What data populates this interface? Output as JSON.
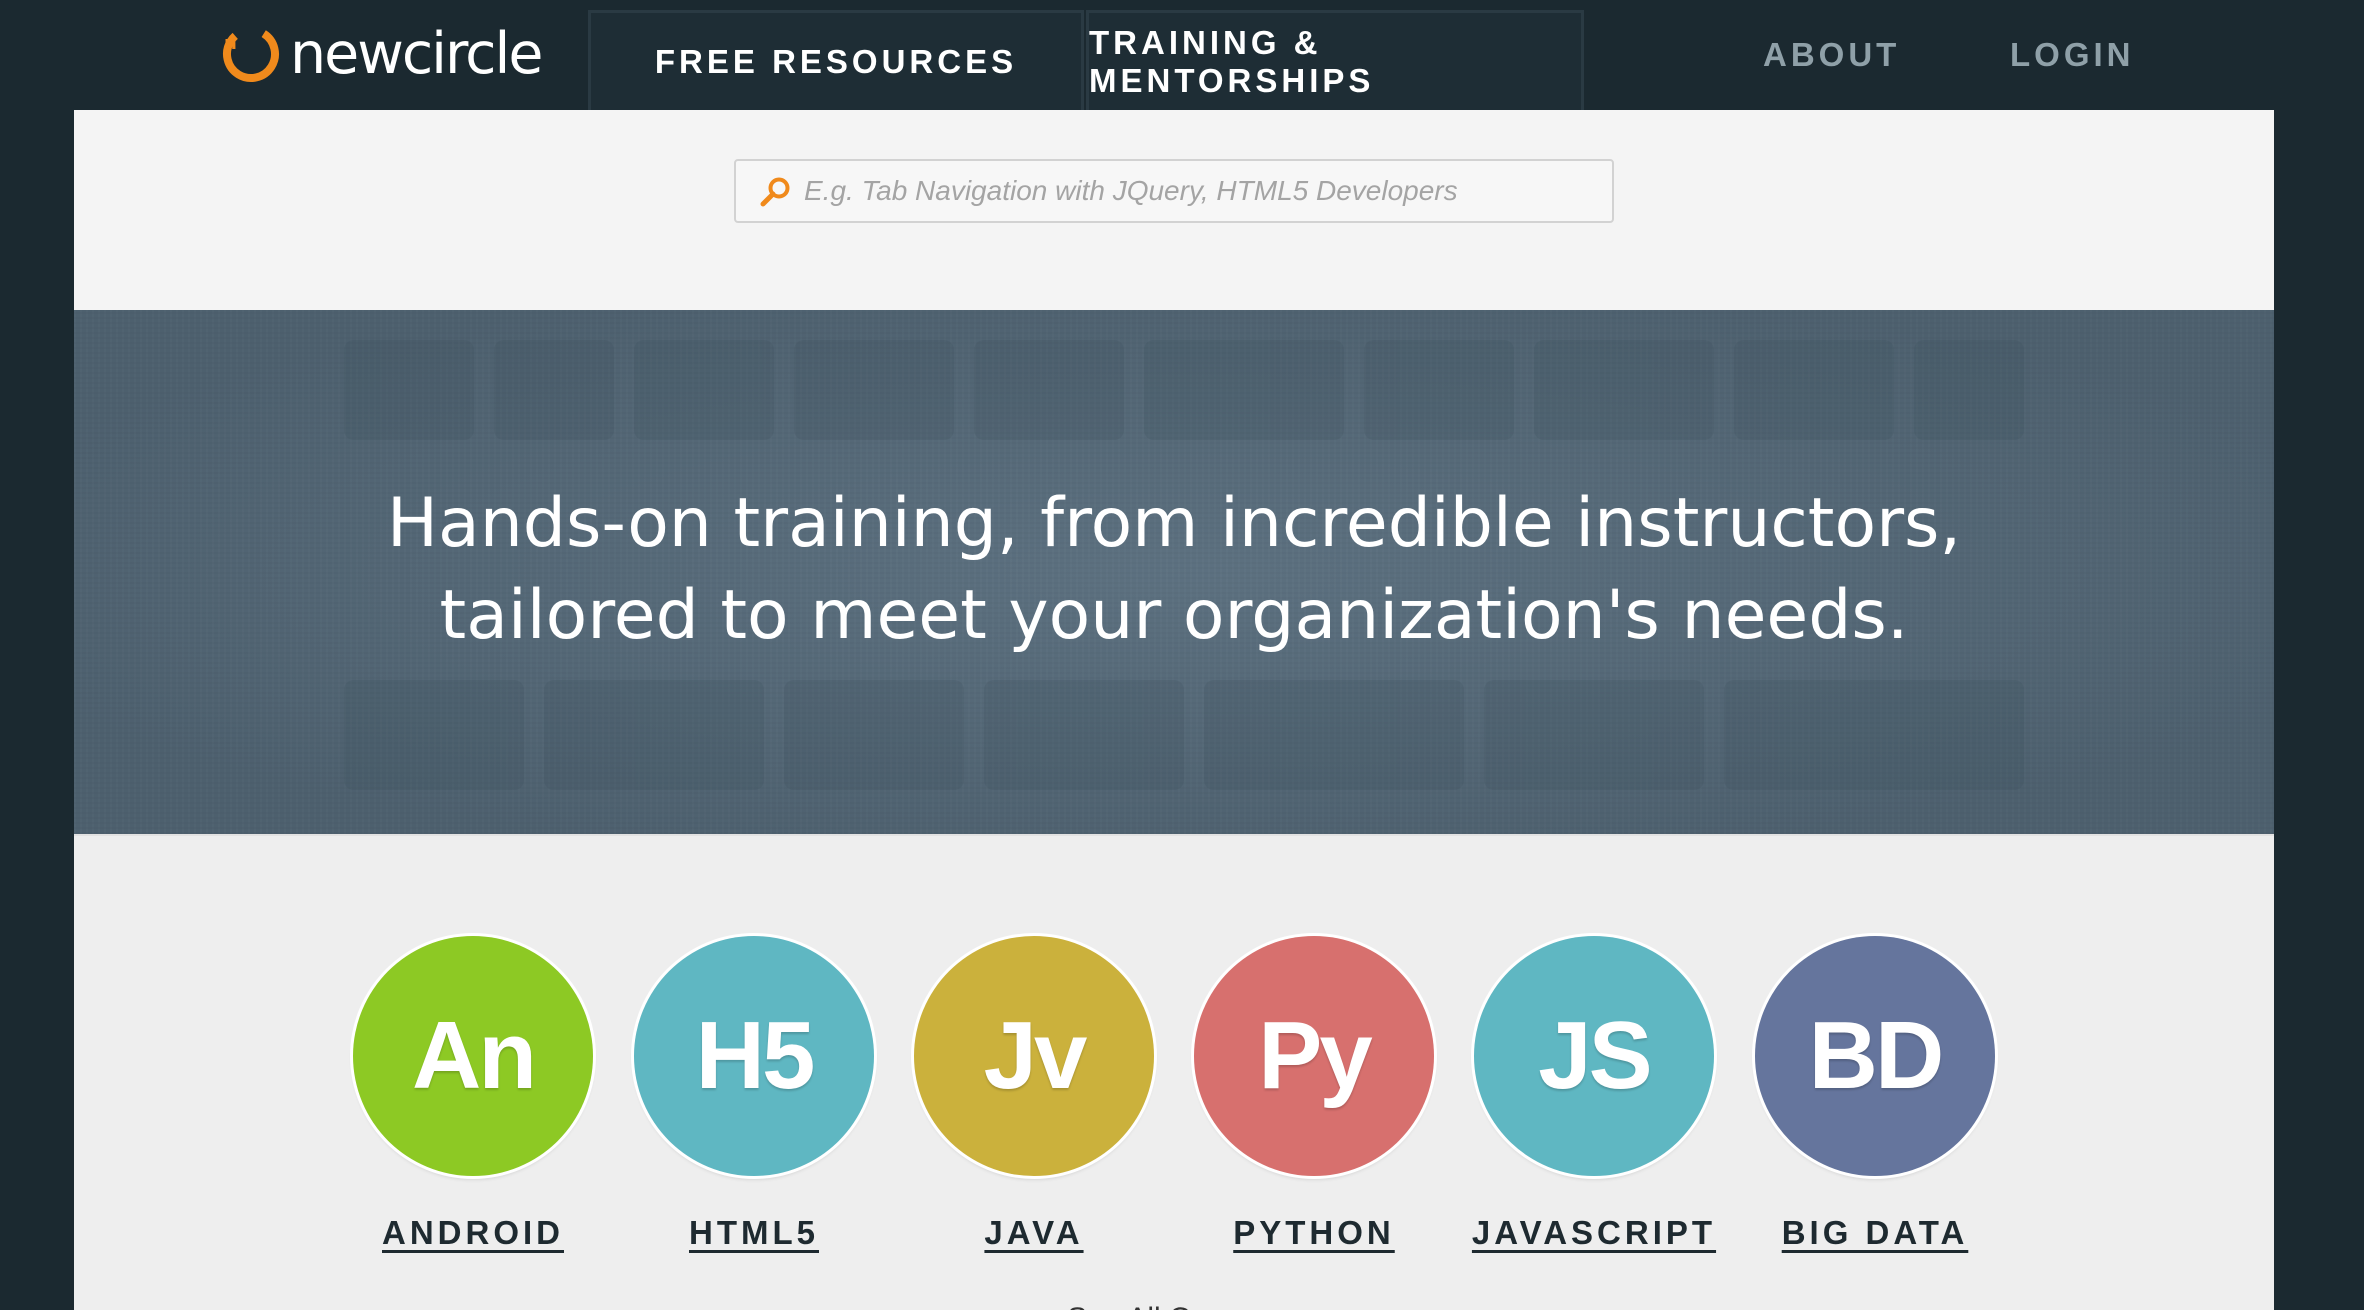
{
  "brand": {
    "name": "newcircle",
    "accent": "#f08a1c"
  },
  "nav": {
    "items": [
      {
        "label": "FREE RESOURCES"
      },
      {
        "label": "TRAINING & MENTORSHIPS"
      },
      {
        "label": "ABOUT"
      },
      {
        "label": "LOGIN"
      }
    ]
  },
  "search": {
    "placeholder": "E.g. Tab Navigation with JQuery, HTML5 Developers",
    "value": "",
    "icon": "search-icon"
  },
  "hero": {
    "line1": "Hands-on training, from incredible instructors,",
    "line2": "tailored to meet your organization's needs."
  },
  "courses": [
    {
      "abbr": "An",
      "label": "ANDROID",
      "color": "#8dc924"
    },
    {
      "abbr": "H5",
      "label": "HTML5",
      "color": "#5fb7c2"
    },
    {
      "abbr": "Jv",
      "label": "JAVA",
      "color": "#cbb13c"
    },
    {
      "abbr": "Py",
      "label": "PYTHON",
      "color": "#d7706e"
    },
    {
      "abbr": "JS",
      "label": "JAVASCRIPT",
      "color": "#5fb7c2"
    },
    {
      "abbr": "BD",
      "label": "BIG DATA",
      "color": "#65759d"
    }
  ],
  "see_all": "See All Courses"
}
